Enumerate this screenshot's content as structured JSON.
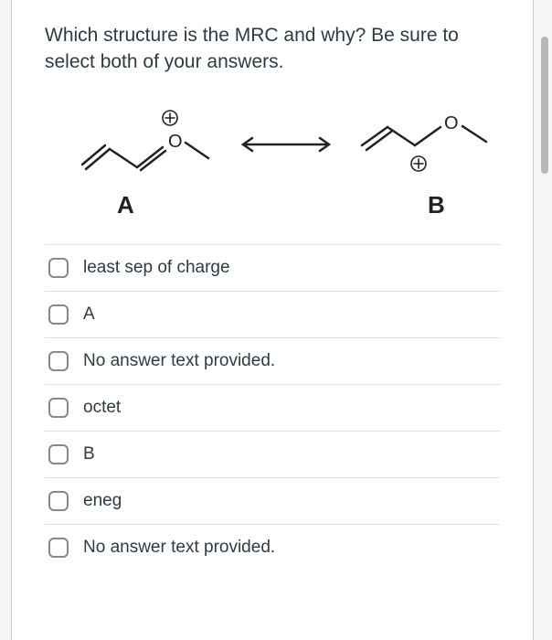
{
  "question": "Which structure is the MRC and why? Be sure to select both of your answers.",
  "labels": {
    "a": "A",
    "b": "B"
  },
  "options": [
    {
      "label": "least sep of charge"
    },
    {
      "label": "A"
    },
    {
      "label": "No answer text provided."
    },
    {
      "label": "octet"
    },
    {
      "label": "B"
    },
    {
      "label": "eneg"
    },
    {
      "label": "No answer text provided."
    }
  ]
}
